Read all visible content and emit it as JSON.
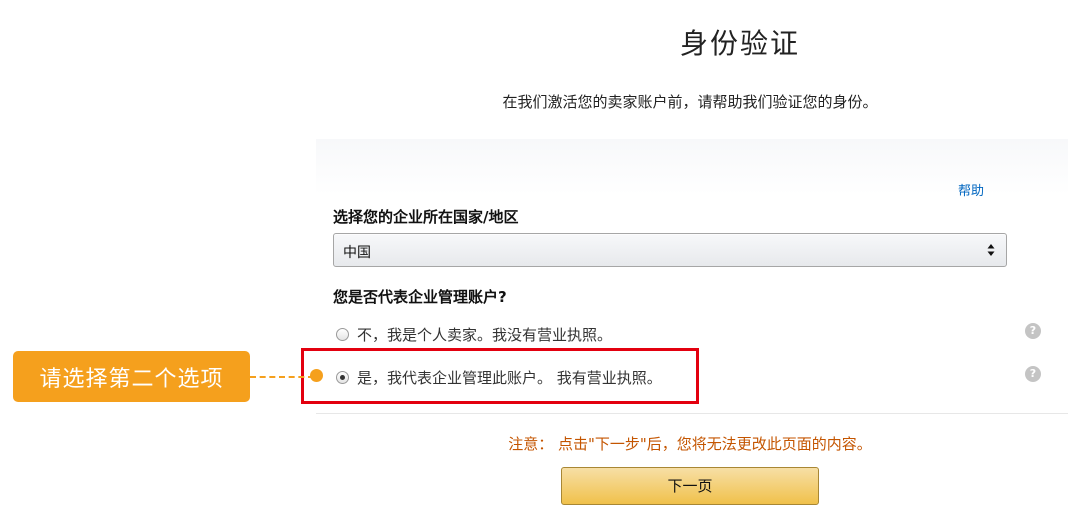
{
  "header": {
    "title": "身份验证",
    "subtitle": "在我们激活您的卖家账户前，请帮助我们验证您的身份。"
  },
  "help_link": "帮助",
  "country": {
    "label": "选择您的企业所在国家/地区",
    "selected": "中国"
  },
  "business_question": {
    "label": "您是否代表企业管理账户?",
    "options": [
      {
        "label": "不，我是个人卖家。我没有营业执照。",
        "checked": false
      },
      {
        "label": "是，我代表企业管理此账户。 我有营业执照。",
        "checked": true
      }
    ]
  },
  "help_icon_glyph": "?",
  "annotation": {
    "callout_text": "请选择第二个选项",
    "callout_color": "#f5a01d",
    "box_color": "#e3000f"
  },
  "notice": "注意： 点击\"下一步\"后，您将无法更改此页面的内容。",
  "next_button": "下一页"
}
